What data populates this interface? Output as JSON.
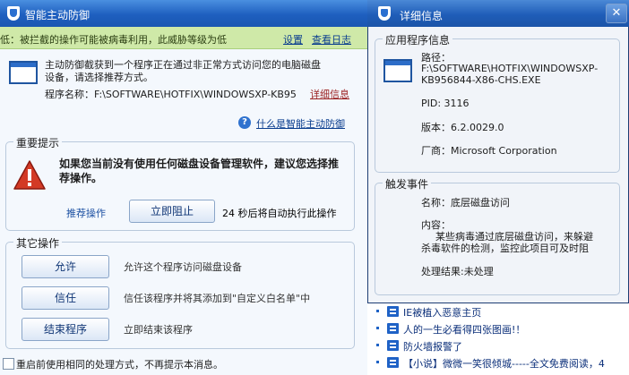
{
  "left_dialog": {
    "title": "智能主动防御",
    "notice": "低：被拦截的操作可能被病毒利用，此威胁等级为低",
    "settings_link": "设置",
    "log_link": "查看日志",
    "message": "主动防御截获到一个程序正在通过非正常方式访问您的电脑磁盘设备，请选择推荐方式。",
    "program_label": "程序名称：F:\\SOFTWARE\\HOTFIX\\WINDOWSXP-KB95",
    "detail_link": "详细信息",
    "help_link": "什么是智能主动防御",
    "important": {
      "title": "重要提示",
      "warning": "如果您当前没有使用任何磁盘设备管理软件，建议您选择推荐操作。",
      "recommend_label": "推荐操作",
      "block_button": "立即阻止",
      "countdown": "24 秒后将自动执行此操作"
    },
    "other": {
      "title": "其它操作",
      "options": [
        {
          "button": "允许",
          "desc": "允许这个程序访问磁盘设备"
        },
        {
          "button": "信任",
          "desc": "信任该程序并将其添加到\"自定义白名单\"中"
        },
        {
          "button": "结束程序",
          "desc": "立即结束该程序"
        }
      ]
    },
    "remember_checkbox": "重启前使用相同的处理方式，不再提示本消息。"
  },
  "right_dialog": {
    "title": "详细信息",
    "close_glyph": "✕",
    "app_info": {
      "title": "应用程序信息",
      "path_label": "路径：",
      "path_line1": "F:\\SOFTWARE\\HOTFIX\\WINDOWSXP-",
      "path_line2": "KB956844-X86-CHS.EXE",
      "pid": "PID: 3116",
      "version": "版本：6.2.0029.0",
      "vendor": "厂商：Microsoft Corporation"
    },
    "event": {
      "title": "触发事件",
      "name": "名称：底层磁盘访问",
      "content_label": "内容：",
      "content_line1": "某些病毒通过底层磁盘访问，来躲避",
      "content_line2": "杀毒软件的检测，监控此项目可及时阻",
      "result": "处理结果:未处理"
    }
  },
  "news": [
    "IE被植入恶意主页",
    "人的一生必看得四张图画!！",
    "防火墙报警了",
    "【小说】微微一笑很倾城-----全文免费阅读，4"
  ]
}
